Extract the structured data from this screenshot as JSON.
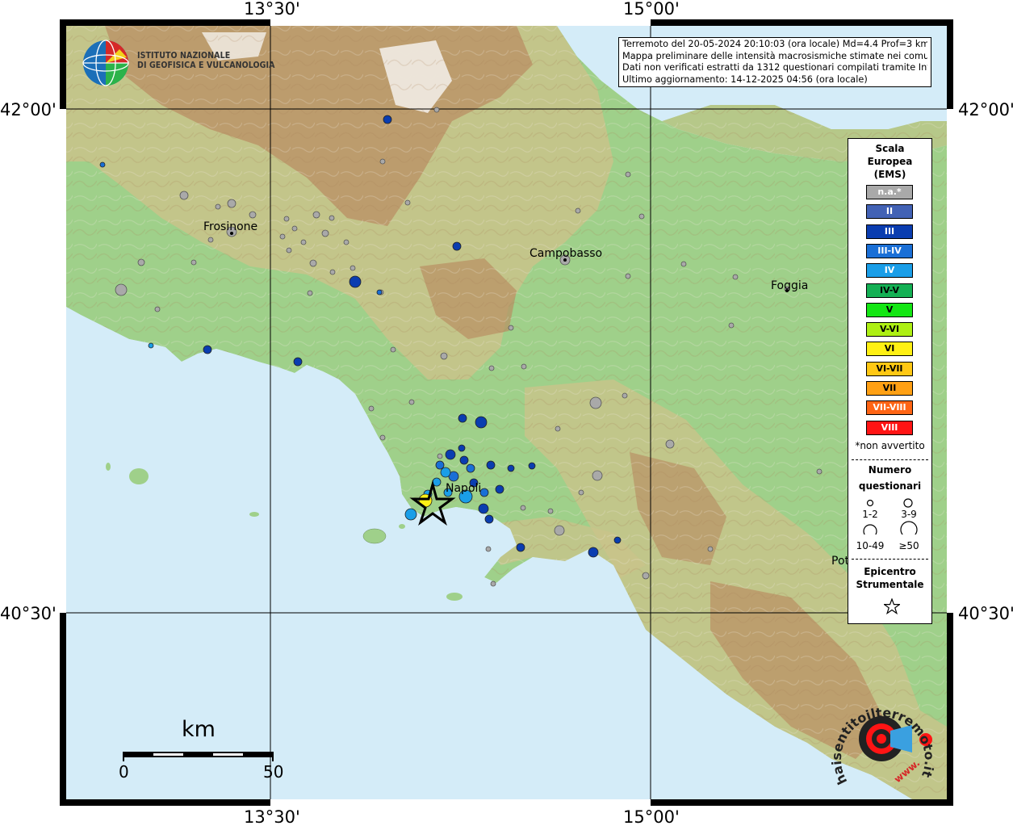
{
  "coordinates": {
    "top_lon_left": "13°30'",
    "top_lon_right": "15°00'",
    "bottom_lon_left": "13°30'",
    "bottom_lon_right": "15°00'",
    "left_lat_top": "42°00'",
    "left_lat_bottom": "40°30'",
    "right_lat_top": "42°00'",
    "right_lat_bottom": "40°30'"
  },
  "agency": {
    "line1": "ISTITUTO NAZIONALE",
    "line2": "DI GEOFISICA E VULCANOLOGIA"
  },
  "info": {
    "line1": "Terremoto del 20-05-2024 20:10:03 (ora locale) Md=4.4 Prof=3 km",
    "line2": "Mappa preliminare delle intensità macrosismiche stimate nei comuni",
    "line3": "Dati non verificati estratti da 1312 questionari compilati tramite Internet.",
    "line4": "Ultimo aggiornamento: 14-12-2025 04:56 (ora locale)"
  },
  "cities": {
    "frosinone": "Frosinone",
    "campobasso": "Campobasso",
    "foggia": "Foggia",
    "napoli": "Napoli",
    "potenza": "Pot"
  },
  "legend": {
    "title_line1": "Scala",
    "title_line2": "Europea",
    "title_line3": "(EMS)",
    "items": [
      {
        "label": "n.a.*",
        "color": "#a9a9a9",
        "text_color": "#ffffff"
      },
      {
        "label": "II",
        "color": "#4262b5",
        "text_color": "#ffffff"
      },
      {
        "label": "III",
        "color": "#0a3db0",
        "text_color": "#ffffff"
      },
      {
        "label": "III-IV",
        "color": "#1a6fd6",
        "text_color": "#ffffff"
      },
      {
        "label": "IV",
        "color": "#1a9ee8",
        "text_color": "#ffffff"
      },
      {
        "label": "IV-V",
        "color": "#14b054",
        "text_color": "#000000"
      },
      {
        "label": "V",
        "color": "#14e614",
        "text_color": "#000000"
      },
      {
        "label": "V-VI",
        "color": "#aef014",
        "text_color": "#000000"
      },
      {
        "label": "VI",
        "color": "#fff014",
        "text_color": "#000000"
      },
      {
        "label": "VI-VII",
        "color": "#ffc814",
        "text_color": "#000000"
      },
      {
        "label": "VII",
        "color": "#ffa014",
        "text_color": "#000000"
      },
      {
        "label": "VII-VIII",
        "color": "#ff6414",
        "text_color": "#ffffff"
      },
      {
        "label": "VIII",
        "color": "#ff1414",
        "text_color": "#ffffff"
      }
    ],
    "note": "*non avvertito",
    "count_title_line1": "Numero",
    "count_title_line2": "questionari",
    "size_labels": [
      "1-2",
      "3-9",
      "10-49",
      "≥50"
    ],
    "epicenter_line1": "Epicentro",
    "epicenter_line2": "Strumentale"
  },
  "scale_bar": {
    "unit": "km",
    "start": "0",
    "end": "50"
  },
  "watermark": {
    "text": "haisentitoilterremoto.it",
    "url": "www."
  },
  "colors": {
    "sea": "#d4ecf8",
    "lowland": "#9fd08a",
    "hills": "#c9c38a",
    "mountains": "#b98e63",
    "peaks": "#f1ece4",
    "grid": "#000000",
    "na": "#a9a9a9",
    "iii": "#0a3db0",
    "iii_iv": "#1a6fd6",
    "iv": "#1a9ee8",
    "vi": "#fff014"
  }
}
